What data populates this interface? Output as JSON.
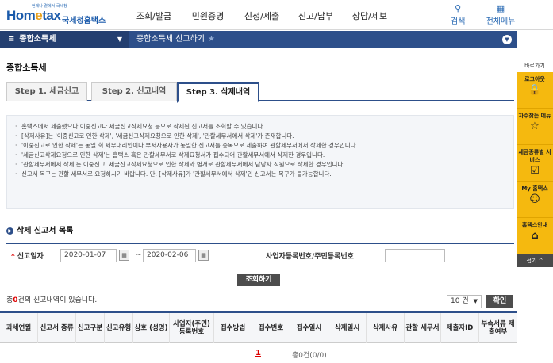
{
  "header": {
    "logo_tagline": "언제나 곁에서 국세청",
    "logo_main": "Hom",
    "logo_e": "e",
    "logo_tax": "tax",
    "logo_korean": "국세청홈택스",
    "menu": [
      "조회/발급",
      "민원증명",
      "신청/제출",
      "신고/납부",
      "상담/제보"
    ],
    "search_label": "검색",
    "allmenu_label": "전체메뉴"
  },
  "subnav": {
    "menu_label": "종합소득세",
    "breadcrumb": "종합소득세 신고하기"
  },
  "quickbar": {
    "title": "바로가기",
    "items": [
      "로그아웃",
      "자주찾는 메뉴",
      "세금종류별 서비스",
      "My 홈택스",
      "홈택스안내"
    ],
    "close_label": "접기 ^"
  },
  "page": {
    "title": "종합소득세",
    "tabs": [
      "Step 1. 세금신고",
      "Step 2. 신고내역",
      "Step 3. 삭제내역"
    ],
    "active_tab": 2
  },
  "notice": [
    "홈택스에서 제출했으나 이중신고나 세금신고삭제요청 등으로 삭제된 신고서를 조회할 수 있습니다.",
    "[삭제사유]는 '이중신고로 인한 삭제', '세금신고삭제요청으로 인한 삭제', '관할세무서에서 삭제'가 존재합니다.",
    "'이중신고로 인한 삭제'는 동일 회 세무대리인이나 부서사용자가 동일한 신고서를 중복으로 제출하여 관할세무서에서 삭제한 경우입니다.",
    "'세금신고삭제요청으로 인한 삭제'는 홈택스 혹은 관할세무서로 삭제요청서가 접수되어 관할세무서에서 삭제한 경우입니다.",
    "'관할세무서에서 삭제'는 이중신고, 세금신고삭제요청으로 인한 삭제와 별개로 관할세무서에서 담당자 직원으로 삭제한 경우입니다.",
    "신고서 복구는 관할 세무서로 요청하시기 바랍니다. 단, [삭제사유]가 '관할세무서에서 삭제'인 신고서는 복구가 불가능합니다."
  ],
  "list": {
    "section_title": "삭제 신고서 목록",
    "date_label": "신고일자",
    "date_from": "2020-01-07",
    "date_to": "2020-02-06",
    "tilde": "~",
    "biz_label": "사업자등록번호/주민등록번호",
    "biz_value": "",
    "search_button": "조회하기",
    "count_prefix": "총",
    "count_num": "0",
    "count_suffix": "건의 신고내역이 있습니다.",
    "page_size": "10 건",
    "ok_button": "확인",
    "columns": [
      "과세연월",
      "신고서 종류",
      "신고구분",
      "신고유형",
      "상호 (성명)",
      "사업자(주민) 등록번호",
      "접수방법",
      "접수번호",
      "접수일시",
      "삭제일시",
      "삭제사유",
      "관할 세무서",
      "제출자ID",
      "부속서류 제출여부"
    ],
    "page_number": "1",
    "total": "총0건(0/0)"
  }
}
